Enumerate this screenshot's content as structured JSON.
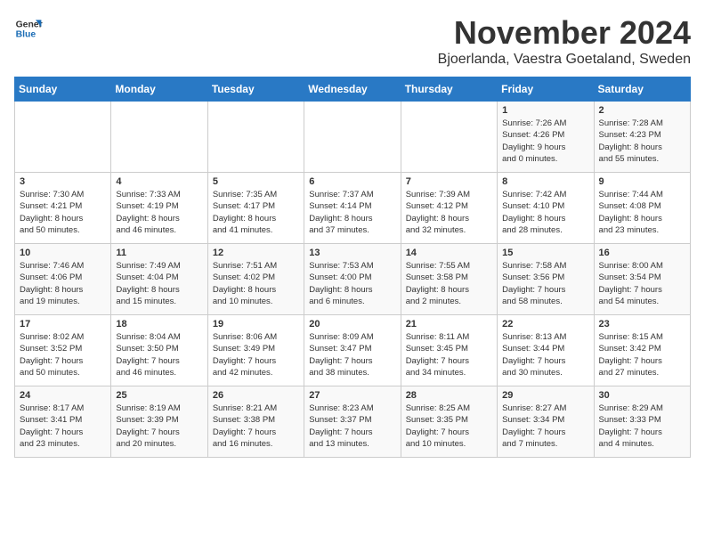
{
  "logo": {
    "general": "General",
    "blue": "Blue"
  },
  "title": "November 2024",
  "subtitle": "Bjoerlanda, Vaestra Goetaland, Sweden",
  "weekdays": [
    "Sunday",
    "Monday",
    "Tuesday",
    "Wednesday",
    "Thursday",
    "Friday",
    "Saturday"
  ],
  "weeks": [
    [
      {
        "day": "",
        "info": ""
      },
      {
        "day": "",
        "info": ""
      },
      {
        "day": "",
        "info": ""
      },
      {
        "day": "",
        "info": ""
      },
      {
        "day": "",
        "info": ""
      },
      {
        "day": "1",
        "info": "Sunrise: 7:26 AM\nSunset: 4:26 PM\nDaylight: 9 hours\nand 0 minutes."
      },
      {
        "day": "2",
        "info": "Sunrise: 7:28 AM\nSunset: 4:23 PM\nDaylight: 8 hours\nand 55 minutes."
      }
    ],
    [
      {
        "day": "3",
        "info": "Sunrise: 7:30 AM\nSunset: 4:21 PM\nDaylight: 8 hours\nand 50 minutes."
      },
      {
        "day": "4",
        "info": "Sunrise: 7:33 AM\nSunset: 4:19 PM\nDaylight: 8 hours\nand 46 minutes."
      },
      {
        "day": "5",
        "info": "Sunrise: 7:35 AM\nSunset: 4:17 PM\nDaylight: 8 hours\nand 41 minutes."
      },
      {
        "day": "6",
        "info": "Sunrise: 7:37 AM\nSunset: 4:14 PM\nDaylight: 8 hours\nand 37 minutes."
      },
      {
        "day": "7",
        "info": "Sunrise: 7:39 AM\nSunset: 4:12 PM\nDaylight: 8 hours\nand 32 minutes."
      },
      {
        "day": "8",
        "info": "Sunrise: 7:42 AM\nSunset: 4:10 PM\nDaylight: 8 hours\nand 28 minutes."
      },
      {
        "day": "9",
        "info": "Sunrise: 7:44 AM\nSunset: 4:08 PM\nDaylight: 8 hours\nand 23 minutes."
      }
    ],
    [
      {
        "day": "10",
        "info": "Sunrise: 7:46 AM\nSunset: 4:06 PM\nDaylight: 8 hours\nand 19 minutes."
      },
      {
        "day": "11",
        "info": "Sunrise: 7:49 AM\nSunset: 4:04 PM\nDaylight: 8 hours\nand 15 minutes."
      },
      {
        "day": "12",
        "info": "Sunrise: 7:51 AM\nSunset: 4:02 PM\nDaylight: 8 hours\nand 10 minutes."
      },
      {
        "day": "13",
        "info": "Sunrise: 7:53 AM\nSunset: 4:00 PM\nDaylight: 8 hours\nand 6 minutes."
      },
      {
        "day": "14",
        "info": "Sunrise: 7:55 AM\nSunset: 3:58 PM\nDaylight: 8 hours\nand 2 minutes."
      },
      {
        "day": "15",
        "info": "Sunrise: 7:58 AM\nSunset: 3:56 PM\nDaylight: 7 hours\nand 58 minutes."
      },
      {
        "day": "16",
        "info": "Sunrise: 8:00 AM\nSunset: 3:54 PM\nDaylight: 7 hours\nand 54 minutes."
      }
    ],
    [
      {
        "day": "17",
        "info": "Sunrise: 8:02 AM\nSunset: 3:52 PM\nDaylight: 7 hours\nand 50 minutes."
      },
      {
        "day": "18",
        "info": "Sunrise: 8:04 AM\nSunset: 3:50 PM\nDaylight: 7 hours\nand 46 minutes."
      },
      {
        "day": "19",
        "info": "Sunrise: 8:06 AM\nSunset: 3:49 PM\nDaylight: 7 hours\nand 42 minutes."
      },
      {
        "day": "20",
        "info": "Sunrise: 8:09 AM\nSunset: 3:47 PM\nDaylight: 7 hours\nand 38 minutes."
      },
      {
        "day": "21",
        "info": "Sunrise: 8:11 AM\nSunset: 3:45 PM\nDaylight: 7 hours\nand 34 minutes."
      },
      {
        "day": "22",
        "info": "Sunrise: 8:13 AM\nSunset: 3:44 PM\nDaylight: 7 hours\nand 30 minutes."
      },
      {
        "day": "23",
        "info": "Sunrise: 8:15 AM\nSunset: 3:42 PM\nDaylight: 7 hours\nand 27 minutes."
      }
    ],
    [
      {
        "day": "24",
        "info": "Sunrise: 8:17 AM\nSunset: 3:41 PM\nDaylight: 7 hours\nand 23 minutes."
      },
      {
        "day": "25",
        "info": "Sunrise: 8:19 AM\nSunset: 3:39 PM\nDaylight: 7 hours\nand 20 minutes."
      },
      {
        "day": "26",
        "info": "Sunrise: 8:21 AM\nSunset: 3:38 PM\nDaylight: 7 hours\nand 16 minutes."
      },
      {
        "day": "27",
        "info": "Sunrise: 8:23 AM\nSunset: 3:37 PM\nDaylight: 7 hours\nand 13 minutes."
      },
      {
        "day": "28",
        "info": "Sunrise: 8:25 AM\nSunset: 3:35 PM\nDaylight: 7 hours\nand 10 minutes."
      },
      {
        "day": "29",
        "info": "Sunrise: 8:27 AM\nSunset: 3:34 PM\nDaylight: 7 hours\nand 7 minutes."
      },
      {
        "day": "30",
        "info": "Sunrise: 8:29 AM\nSunset: 3:33 PM\nDaylight: 7 hours\nand 4 minutes."
      }
    ]
  ]
}
